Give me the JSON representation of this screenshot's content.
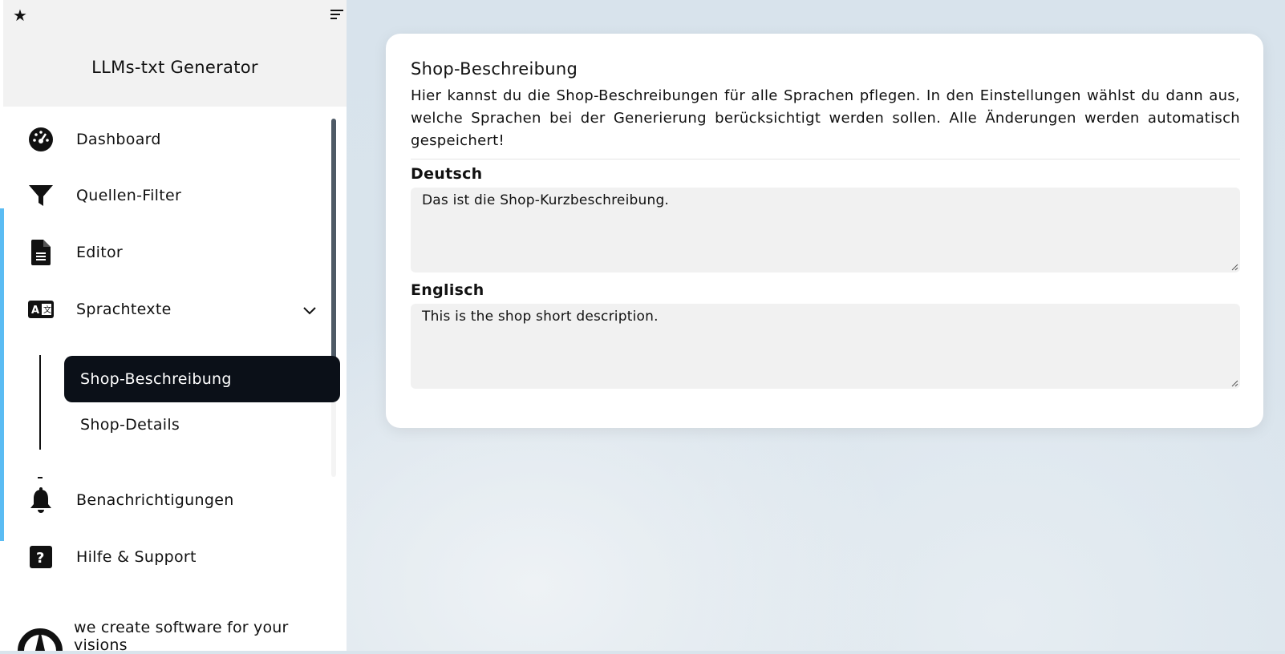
{
  "app": {
    "title": "LLMs-txt Generator"
  },
  "sidebar": {
    "items": [
      {
        "label": "Dashboard",
        "icon": "dashboard-gauge-icon"
      },
      {
        "label": "Quellen-Filter",
        "icon": "filter-icon"
      },
      {
        "label": "Editor",
        "icon": "document-icon"
      },
      {
        "label": "Sprachtexte",
        "icon": "translate-icon",
        "expanded": true
      },
      {
        "label": "Benachrichtigungen",
        "icon": "bell-icon"
      },
      {
        "label": "Hilfe & Support",
        "icon": "help-icon"
      }
    ],
    "subitems": [
      {
        "label": "Shop-Beschreibung",
        "active": true
      },
      {
        "label": "Shop-Details",
        "active": false
      }
    ],
    "footer_text": "we create software for your visions"
  },
  "main": {
    "title": "Shop-Beschreibung",
    "description": "Hier kannst du die Shop-Beschreibungen für alle Sprachen pflegen. In den Einstellungen wählst du dann aus, welche Sprachen bei der Generierung berücksichtigt werden sollen. Alle Änderungen werden automatisch gespeichert!",
    "languages": [
      {
        "label": "Deutsch",
        "value": "Das ist die Shop-Kurzbeschreibung."
      },
      {
        "label": "Englisch",
        "value": "This is the shop short description."
      }
    ]
  },
  "colors": {
    "accent": "#5bbcf3",
    "active_bg": "#0b1018",
    "textarea_bg": "#f1f1f1"
  }
}
